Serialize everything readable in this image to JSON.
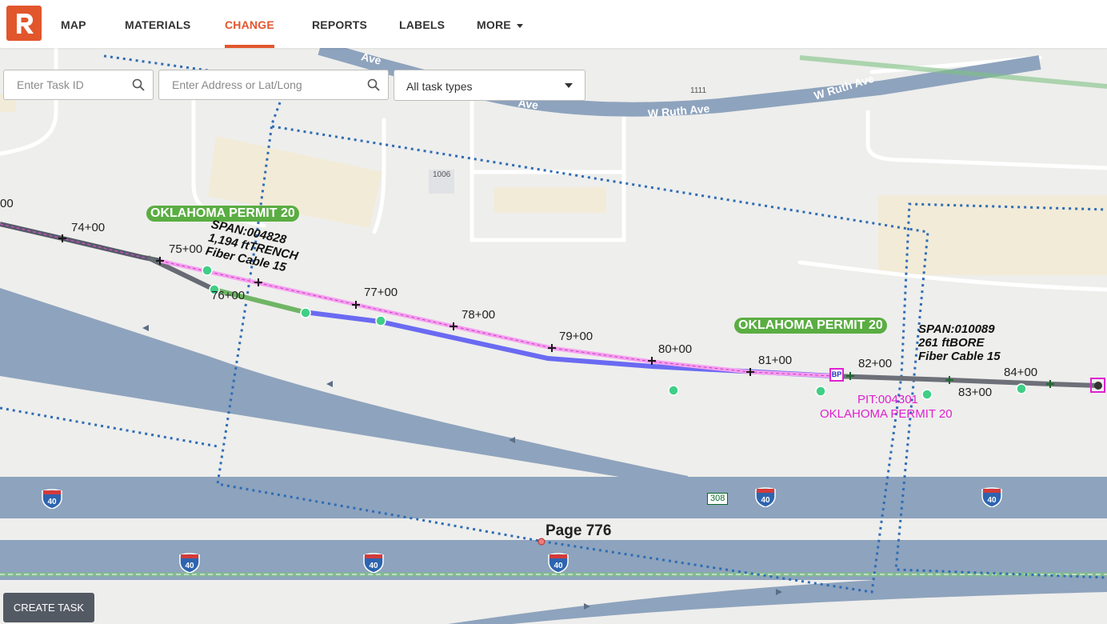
{
  "nav": {
    "logo": "R",
    "items": [
      {
        "label": "MAP"
      },
      {
        "label": "MATERIALS"
      },
      {
        "label": "CHANGE"
      },
      {
        "label": "REPORTS"
      },
      {
        "label": "LABELS"
      },
      {
        "label": "MORE"
      }
    ],
    "active": "CHANGE",
    "accent_color": "#e2562c"
  },
  "search": {
    "task_id_placeholder": "Enter Task ID",
    "address_placeholder": "Enter Address or Lat/Long",
    "task_type_value": "All task types"
  },
  "create_task_label": "CREATE TASK",
  "map": {
    "stations": [
      "00",
      "74+00",
      "75+00",
      "76+00",
      "77+00",
      "78+00",
      "79+00",
      "80+00",
      "81+00",
      "82+00",
      "83+00",
      "84+00"
    ],
    "permits": [
      "OKLAHOMA PERMIT 20",
      "OKLAHOMA PERMIT 20"
    ],
    "span1": {
      "id": "SPAN:004828",
      "length": "1,194 ftTRENCH",
      "cable": "Fiber Cable 15"
    },
    "span2": {
      "id": "SPAN:010089",
      "length": "261 ftBORE",
      "cable": "Fiber Cable 15"
    },
    "pit": {
      "id": "PIT:004301",
      "permit": "OKLAHOMA PERMIT 20"
    },
    "page_label": "Page 776",
    "bp_label": "BP",
    "streets": [
      "W Ruth Ave",
      "W Ruth Ave",
      "Ave",
      "Ave"
    ],
    "buildings": [
      "1111",
      "1006"
    ],
    "interstate": "40",
    "exit_number": "308"
  }
}
